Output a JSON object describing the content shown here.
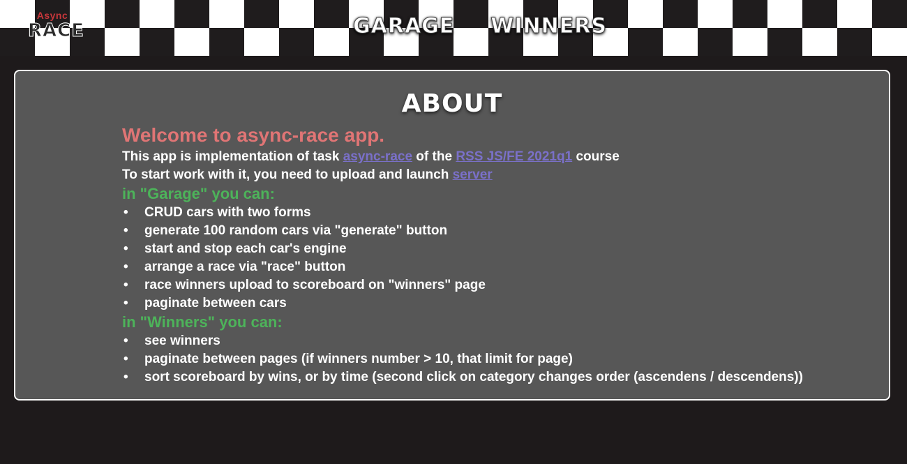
{
  "header": {
    "logo_small": "Async",
    "logo_big": "RACE",
    "nav": [
      {
        "label": "GARAGE"
      },
      {
        "label": "WINNERS"
      }
    ]
  },
  "about": {
    "title": "ABOUT",
    "welcome": "Welcome to async-race app.",
    "intro_prefix": "This app is implementation of task ",
    "intro_link1": "async-race",
    "intro_middle": " of the ",
    "intro_link2": "RSS JS/FE 2021q1",
    "intro_suffix": " course",
    "start_prefix": "To start work with it, you need to upload and launch ",
    "start_link": "server",
    "garage_head": "in \"Garage\" you can:",
    "garage_items": [
      "CRUD cars with two forms",
      "generate 100 random cars via \"generate\" button",
      "start and stop each car's engine",
      "arrange a race via \"race\" button",
      "race winners upload to scoreboard on \"winners\" page",
      "paginate between cars"
    ],
    "winners_head": "in \"Winners\" you can:",
    "winners_items": [
      "see winners",
      "paginate between pages (if winners number > 10, that limit for page)",
      "sort scoreboard by wins, or by time (second click on category changes order (ascendens / descendens))"
    ],
    "bullet": "•"
  },
  "colors": {
    "welcome": "#e07575",
    "section_head": "#4db35a",
    "link": "#7a70c9",
    "panel_bg": "#575757",
    "page_bg": "#1e1a1b"
  }
}
